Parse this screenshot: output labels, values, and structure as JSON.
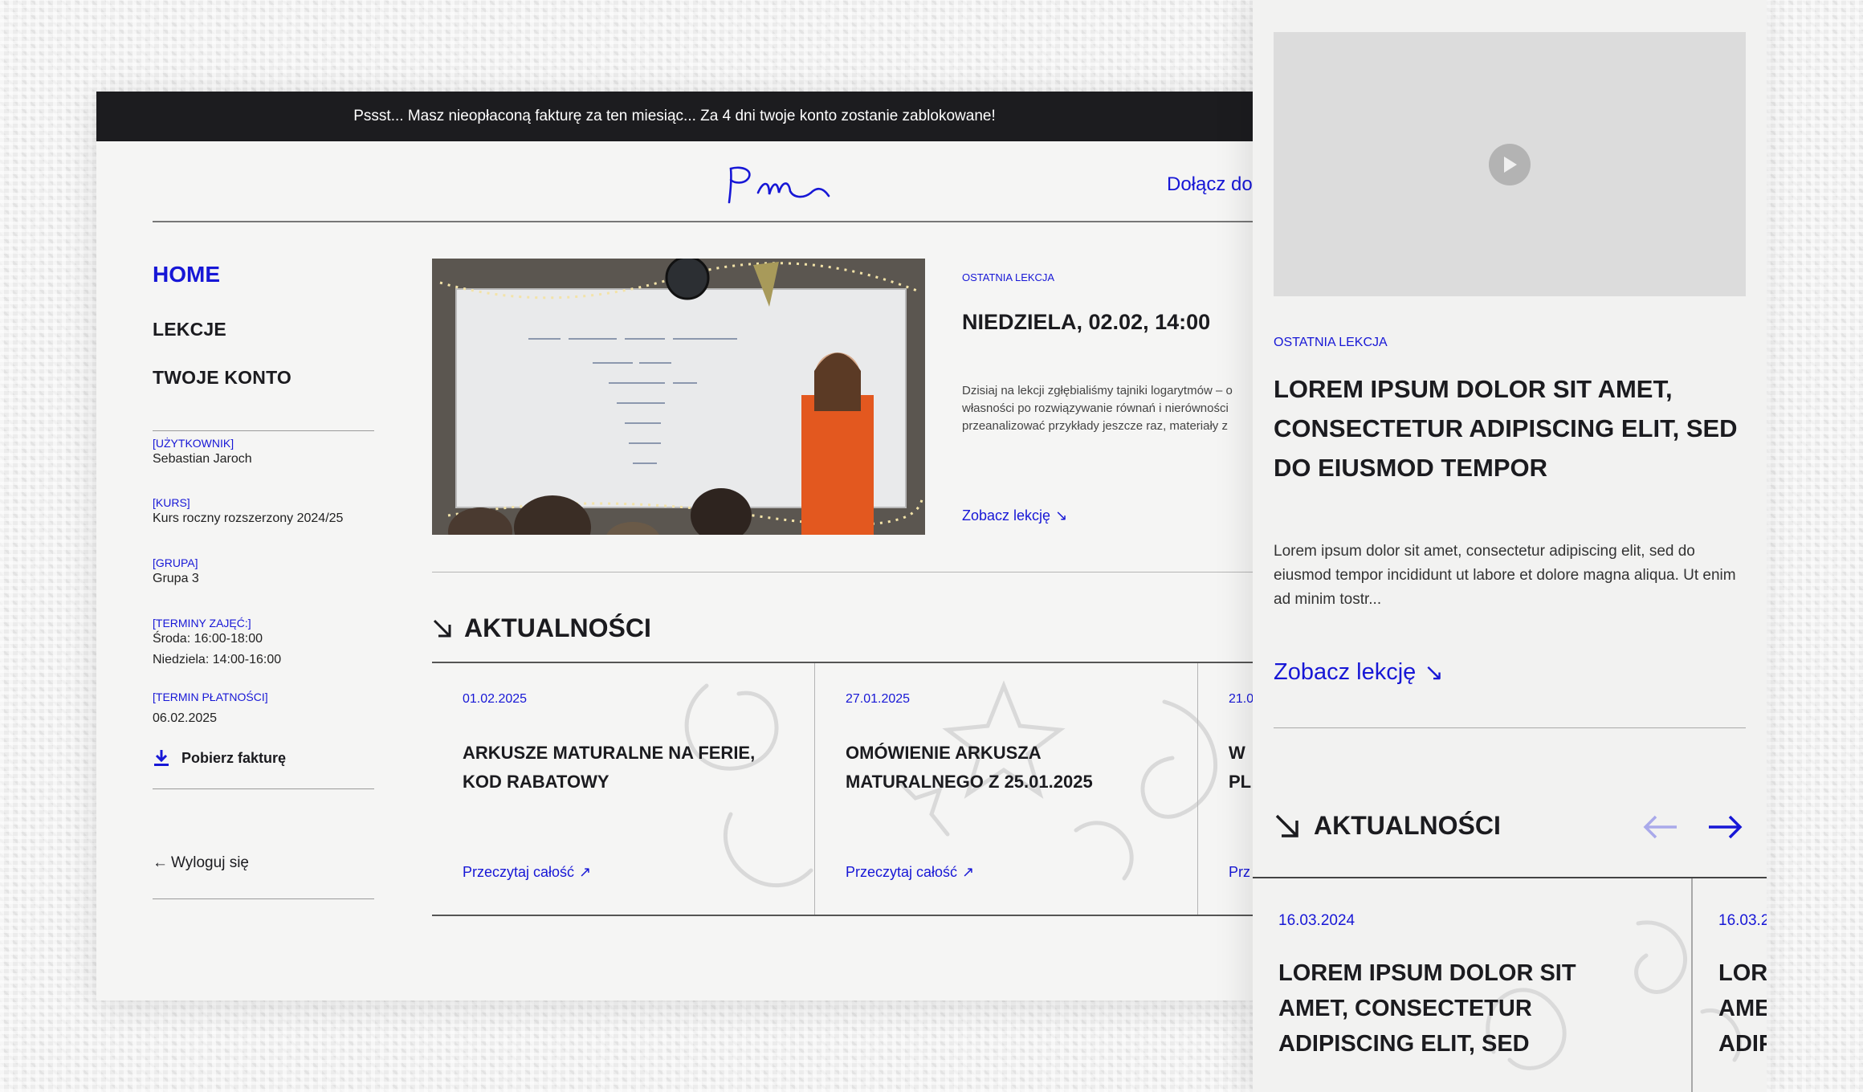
{
  "banner": {
    "text": "Pssst... Masz nieopłaconą fakturę za ten miesiąc... Za 4 dni twoje konto zostanie zablokowane!"
  },
  "header": {
    "logo_text": "PM",
    "join_label": "Dołącz do"
  },
  "nav": {
    "home": "HOME",
    "lessons": "LEKCJE",
    "account": "TWOJE KONTO"
  },
  "user_info": {
    "user_label": "[UŻYTKOWNIK]",
    "user_value": "Sebastian Jaroch",
    "course_label": "[KURS]",
    "course_value": "Kurs roczny rozszerzony 2024/25",
    "group_label": "[GRUPA]",
    "group_value": "Grupa 3",
    "schedule_label": "[TERMINY ZAJĘĆ:]",
    "schedule_1": "Środa: 16:00-18:00",
    "schedule_2": "Niedziela: 14:00-16:00",
    "payment_label": "[TERMIN PŁATNOŚCI]",
    "payment_value": "06.02.2025"
  },
  "download_invoice": "Pobierz fakturę",
  "logout": {
    "arrow": "←",
    "label": "Wyloguj się"
  },
  "last_lesson": {
    "label": "OSTATNIA LEKCJA",
    "title": "NIEDZIELA, 02.02, 14:00",
    "description": "Dzisiaj na lekcji zgłębialiśmy tajniki logarytmów – o własności po rozwiązywanie równań i nierówności przeanalizować przykłady jeszcze raz, materiały z",
    "link": "Zobacz lekcję",
    "link_arrow": "↘"
  },
  "news": {
    "heading": "AKTUALNOŚCI",
    "read_more_arrow": "↗",
    "items": [
      {
        "date": "01.02.2025",
        "title": "ARKUSZE MATURALNE NA FERIE, KOD RABATOWY",
        "link": "Przeczytaj całość"
      },
      {
        "date": "27.01.2025",
        "title": "OMÓWIENIE ARKUSZA MATURALNEGO Z 25.01.2025",
        "link": "Przeczytaj całość"
      },
      {
        "date": "21.0",
        "title": "W PL",
        "link": "Prz"
      }
    ]
  },
  "mobile": {
    "label": "OSTATNIA LEKCJA",
    "title": "LOREM IPSUM DOLOR SIT AMET, CONSECTETUR ADIPISCING ELIT, SED DO EIUSMOD TEMPOR",
    "description": "Lorem ipsum dolor sit amet, consectetur adipiscing elit, sed do eiusmod tempor incididunt ut labore et dolore magna aliqua. Ut enim ad minim tostr...",
    "link": "Zobacz lekcję",
    "link_arrow": "↘",
    "news_heading": "AKTUALNOŚCI",
    "news_items": [
      {
        "date": "16.03.2024",
        "title": "LOREM IPSUM DOLOR SIT AMET, CONSECTETUR ADIPISCING ELIT, SED"
      },
      {
        "date": "16.03.2",
        "title": "LORI AME ADIP"
      }
    ]
  },
  "colors": {
    "accent": "#1717d6",
    "banner_bg": "#1c1c1f",
    "text": "#1b1b1f"
  }
}
